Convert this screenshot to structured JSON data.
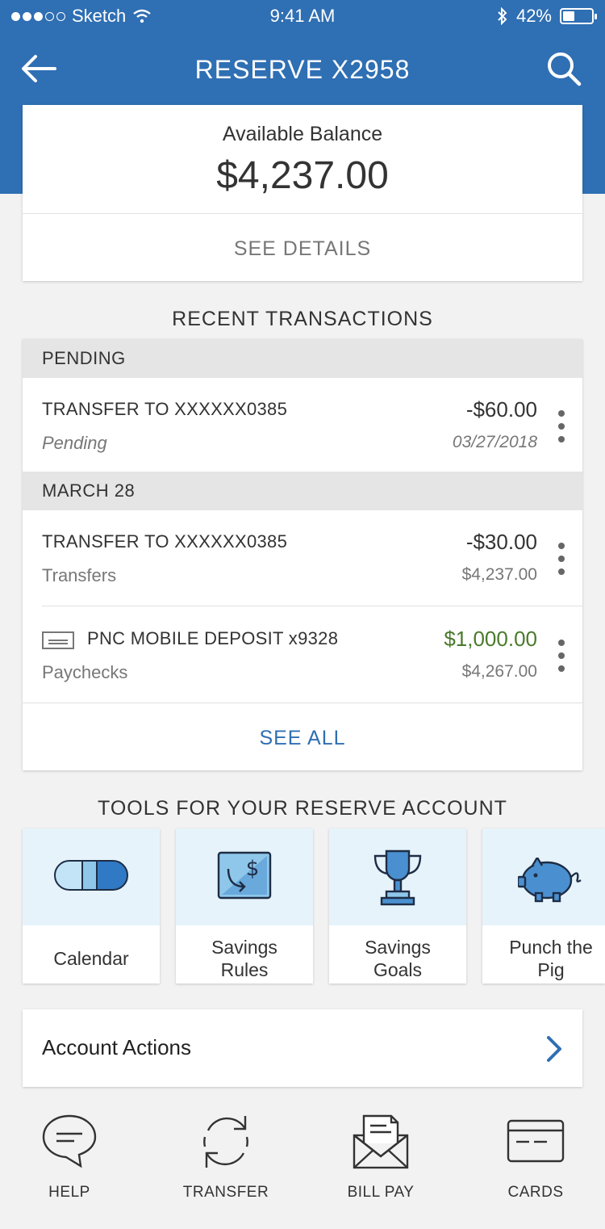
{
  "status_bar": {
    "carrier": "Sketch",
    "time": "9:41 AM",
    "battery_percent": "42%",
    "battery_level": 0.42
  },
  "nav": {
    "title": "RESERVE X2958"
  },
  "balance": {
    "label": "Available Balance",
    "amount": "$4,237.00",
    "details_link": "SEE DETAILS"
  },
  "recent": {
    "title": "RECENT TRANSACTIONS",
    "groups": [
      {
        "header": "PENDING",
        "items": [
          {
            "name": "TRANSFER TO XXXXXX0385",
            "category": "Pending",
            "amount": "-$60.00",
            "meta": "03/27/2018"
          }
        ]
      },
      {
        "header": "MARCH 28",
        "items": [
          {
            "name": "TRANSFER TO XXXXXX0385",
            "category": "Transfers",
            "amount": "-$30.00",
            "meta": "$4,237.00"
          },
          {
            "name": "PNC MOBILE DEPOSIT x9328",
            "category": "Paychecks",
            "amount": "$1,000.00",
            "meta": "$4,267.00"
          }
        ]
      }
    ],
    "see_all": "SEE ALL"
  },
  "tools": {
    "title": "TOOLS FOR YOUR RESERVE ACCOUNT",
    "items": [
      {
        "label": "Calendar",
        "icon": "calendar-pill-icon"
      },
      {
        "label": "Savings Rules",
        "icon": "savings-rules-icon"
      },
      {
        "label": "Savings Goals",
        "icon": "trophy-icon"
      },
      {
        "label": "Punch the Pig",
        "icon": "piggy-bank-icon"
      }
    ]
  },
  "account_actions": {
    "label": "Account Actions"
  },
  "tabbar": {
    "items": [
      {
        "label": "HELP",
        "icon": "chat-bubble-icon"
      },
      {
        "label": "TRANSFER",
        "icon": "transfer-arrows-icon"
      },
      {
        "label": "BILL PAY",
        "icon": "envelope-bill-icon"
      },
      {
        "label": "CARDS",
        "icon": "card-icon"
      }
    ]
  },
  "colors": {
    "brand_blue": "#2f6fb3",
    "positive_green": "#4a7a2b",
    "tool_tile_bg": "#e6f3fb"
  }
}
